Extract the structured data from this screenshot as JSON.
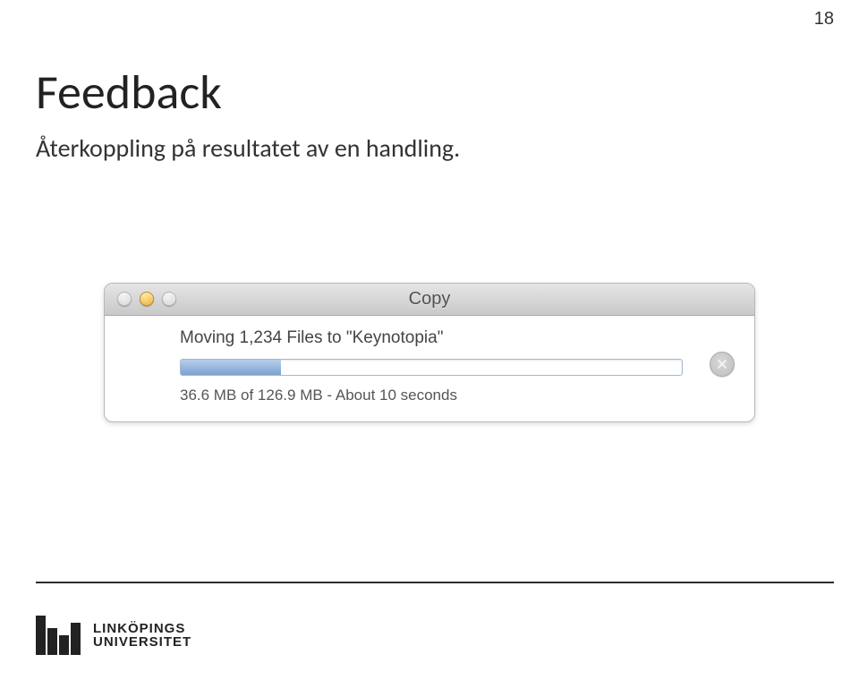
{
  "page_number": "18",
  "heading": "Feedback",
  "subheading": "Återkoppling på resultatet av en handling.",
  "dialog": {
    "title": "Copy",
    "moving_line": "Moving 1,234 Files to \"Keynotopia\"",
    "status_line": "36.6 MB of 126.9 MB - About 10 seconds"
  },
  "footer": {
    "logo_line1": "LINKÖPINGS",
    "logo_line2": "UNIVERSITET"
  }
}
